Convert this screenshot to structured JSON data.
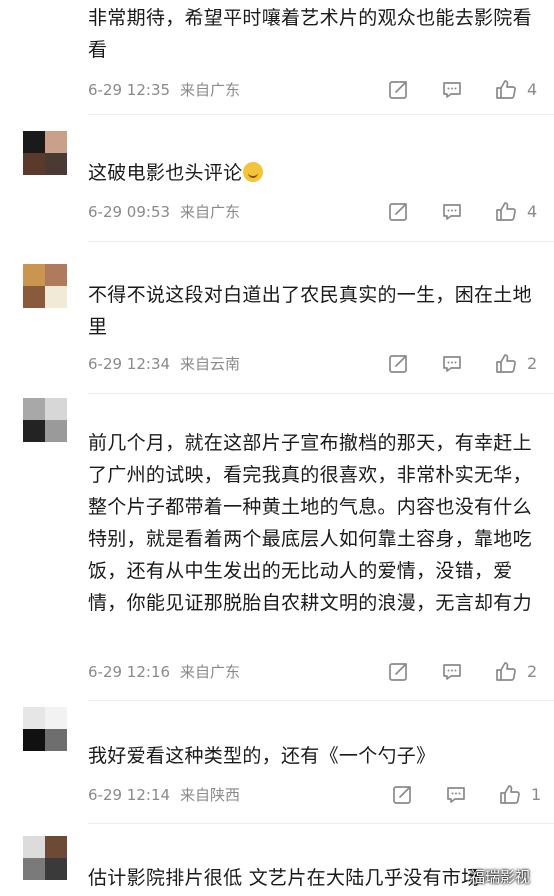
{
  "comments": [
    {
      "text": "非常期待，希望平时嚷着艺术片的观众也能去影院看看",
      "date": "6-29 12:35",
      "location": "来自广东",
      "likes": "4",
      "avatar_colors": [
        "#6b3a2b",
        "#4a4fc0",
        "#ffffff",
        "#ffffff"
      ]
    },
    {
      "text": "这破电影也头评论",
      "emoji": "smile-emoji",
      "date": "6-29 09:53",
      "location": "来自广东",
      "likes": "4",
      "avatar_colors": [
        "#1a1a1a",
        "#c9a08a",
        "#5b3a2c",
        "#4a3a33"
      ]
    },
    {
      "text": "不得不说这段对白道出了农民真实的一生，困在土地里",
      "date": "6-29 12:34",
      "location": "来自云南",
      "likes": "2",
      "avatar_colors": [
        "#c9954f",
        "#b07a5c",
        "#8a5a3c",
        "#f1ead6"
      ]
    },
    {
      "text": "前几个月，就在这部片子宣布撤档的那天，有幸赶上了广州的试映，看完我真的很喜欢，非常朴实无华，整个片子都带着一种黄土地的气息。内容也没有什么特别，就是看着两个最底层人如何靠土容身，靠地吃饭，还有从中生发出的无比动人的爱情，没错，爱情，你能见证那脱胎自农耕文明的浪漫，无言却有力",
      "date": "6-29 12:16",
      "location": "来自广东",
      "likes": "2",
      "avatar_colors": [
        "#a8a8a8",
        "#d7d7d7",
        "#232323",
        "#9a9a9a"
      ]
    },
    {
      "text": "我好爱看这种类型的，还有《一个勺子》",
      "date": "6-29 12:14",
      "location": "来自陕西",
      "likes": "1",
      "avatar_colors": [
        "#e6e6e6",
        "#f2f2f2",
        "#111111",
        "#6e6e6e"
      ]
    },
    {
      "text": "估计影院排片很低 文艺片在大陆几乎没有市场",
      "avatar_colors": [
        "#dcdcdc",
        "#6d4a35",
        "#7a7a7a",
        "#3a3a3a"
      ]
    }
  ],
  "icons": {
    "share": "share-icon",
    "comment": "comment-icon",
    "like": "thumbs-up-icon"
  },
  "watermark": "福瑞影视"
}
